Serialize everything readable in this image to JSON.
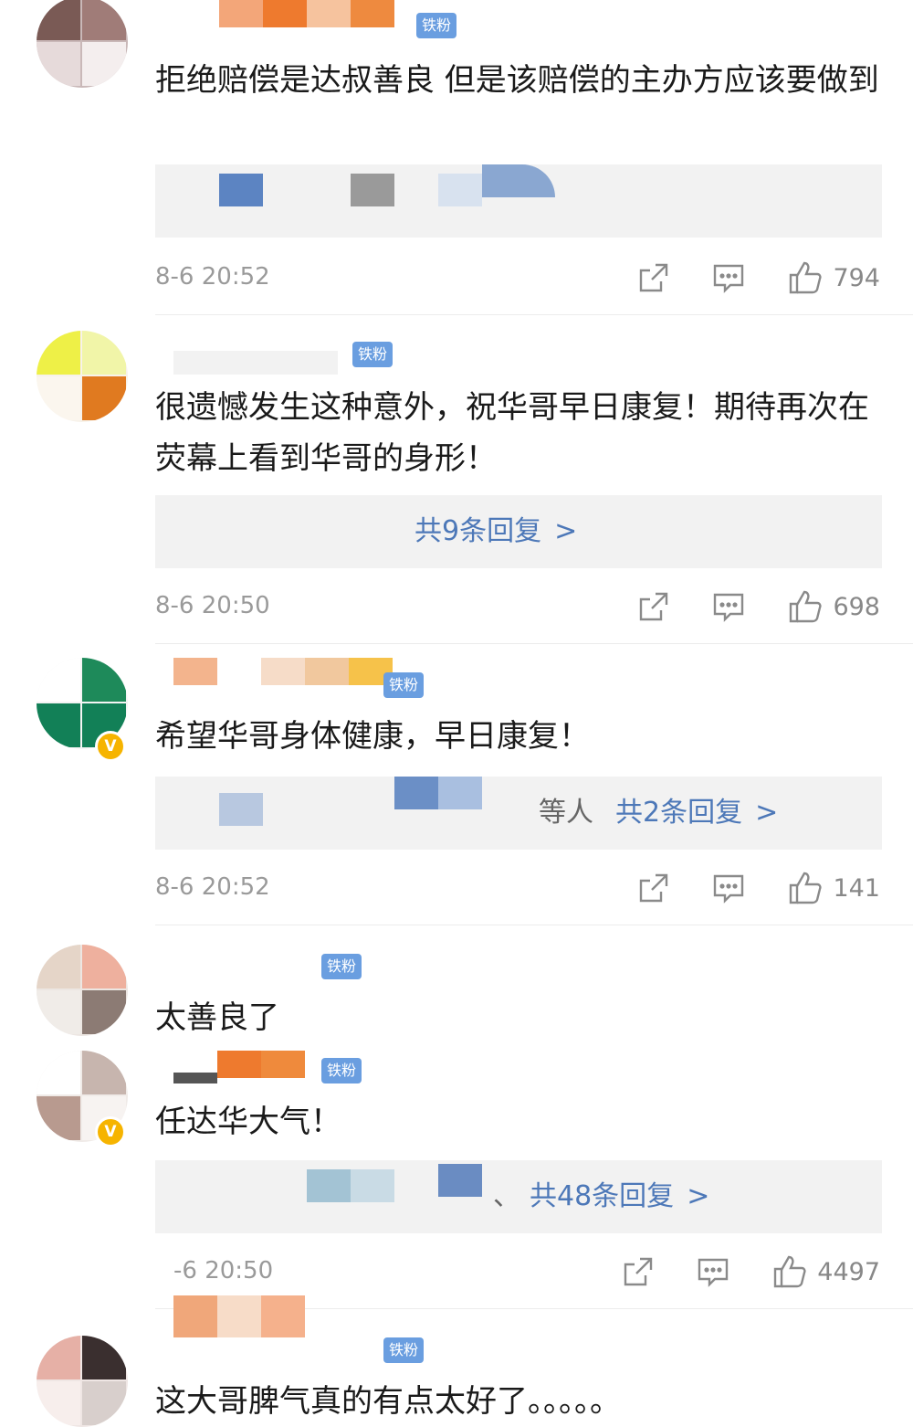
{
  "badge_label": "铁粉",
  "colors": {
    "link": "#4d78b8",
    "badge": "#6a9ee0",
    "verified": "#f6b400"
  },
  "comments": [
    {
      "text": "拒绝赔偿是达叔善良 但是该赔偿的主办方应该要做到",
      "time": "8-6 20:52",
      "likes": "794",
      "replies_label": ""
    },
    {
      "text": "很遗憾发生这种意外，祝华哥早日康复！期待再次在荧幕上看到华哥的身形！",
      "time": "8-6 20:50",
      "likes": "698",
      "replies_label": "共9条回复"
    },
    {
      "text": "希望华哥身体健康，早日康复！",
      "time": "8-6 20:52",
      "likes": "141",
      "replies_label": "共2条回复",
      "reply_prefix": "等人"
    },
    {
      "text": "太善良了",
      "time": "",
      "likes": "",
      "replies_label": ""
    },
    {
      "text": "任达华大气！",
      "time": "-6 20:50",
      "likes": "4497",
      "replies_label": "共48条回复",
      "reply_prefix": "、"
    },
    {
      "text": "这大哥脾气真的有点太好了。。。。。",
      "time": "",
      "likes": "",
      "replies_label": ""
    }
  ],
  "icons": {
    "share": "share-icon",
    "comment": "comment-icon",
    "like": "thumbs-up-icon"
  },
  "chevron": ">"
}
